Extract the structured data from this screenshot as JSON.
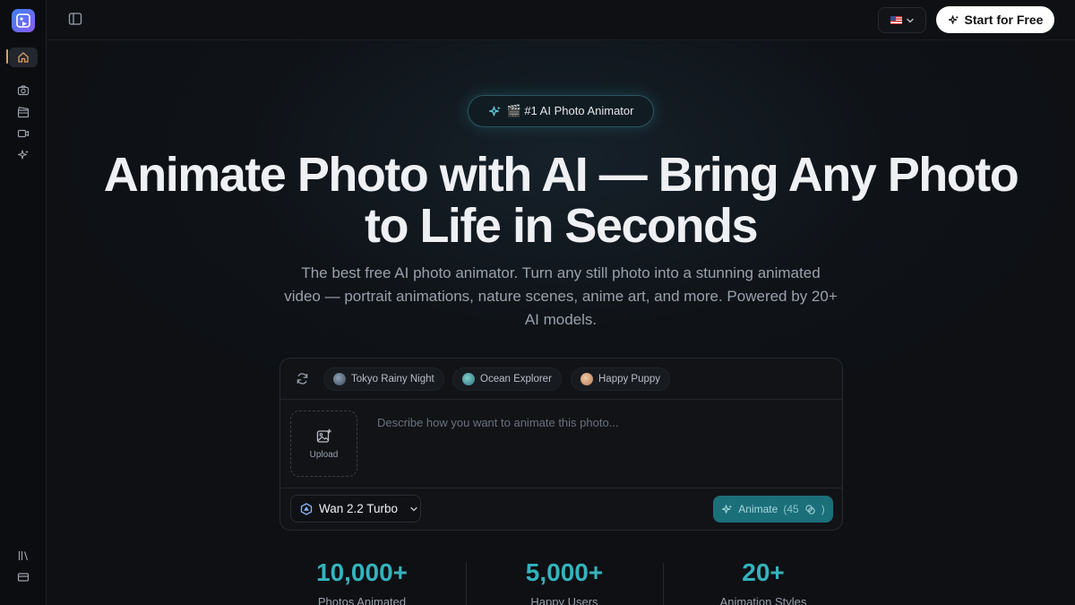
{
  "header": {
    "cta_label": "Start for Free"
  },
  "sidebar": {
    "items": [
      {
        "name": "home",
        "icon": "home-icon",
        "active": true
      },
      {
        "name": "photo",
        "icon": "camera-icon"
      },
      {
        "name": "video-clapper",
        "icon": "clapperboard-icon"
      },
      {
        "name": "video",
        "icon": "video-camera-icon"
      },
      {
        "name": "ai-effects",
        "icon": "sparkles-icon"
      }
    ],
    "bottom_items": [
      {
        "name": "library",
        "icon": "library-icon"
      },
      {
        "name": "billing",
        "icon": "credit-card-icon"
      }
    ]
  },
  "hero": {
    "badge": "🎬 #1 AI Photo Animator",
    "headline_line1": "Animate Photo with AI — Bring Any Photo",
    "headline_line2": "to Life in Seconds",
    "subhead": "The best free AI photo animator. Turn any still photo into a stunning animated video — portrait animations, nature scenes, anime art, and more. Powered by 20+ AI models."
  },
  "composer": {
    "chips": [
      {
        "label": "Tokyo Rainy Night"
      },
      {
        "label": "Ocean Explorer"
      },
      {
        "label": "Happy Puppy"
      }
    ],
    "upload_label": "Upload",
    "prompt_placeholder": "Describe how you want to animate this photo...",
    "model_label": "Wan 2.2 Turbo",
    "animate_label": "Animate",
    "animate_cost": "45"
  },
  "stats": [
    {
      "value": "10,000+",
      "label": "Photos Animated"
    },
    {
      "value": "5,000+",
      "label": "Happy Users"
    },
    {
      "value": "20+",
      "label": "Animation Styles"
    }
  ],
  "colors": {
    "accent": "#34b3bd",
    "background": "#0f1115",
    "animate_button": "#1a6f79"
  }
}
